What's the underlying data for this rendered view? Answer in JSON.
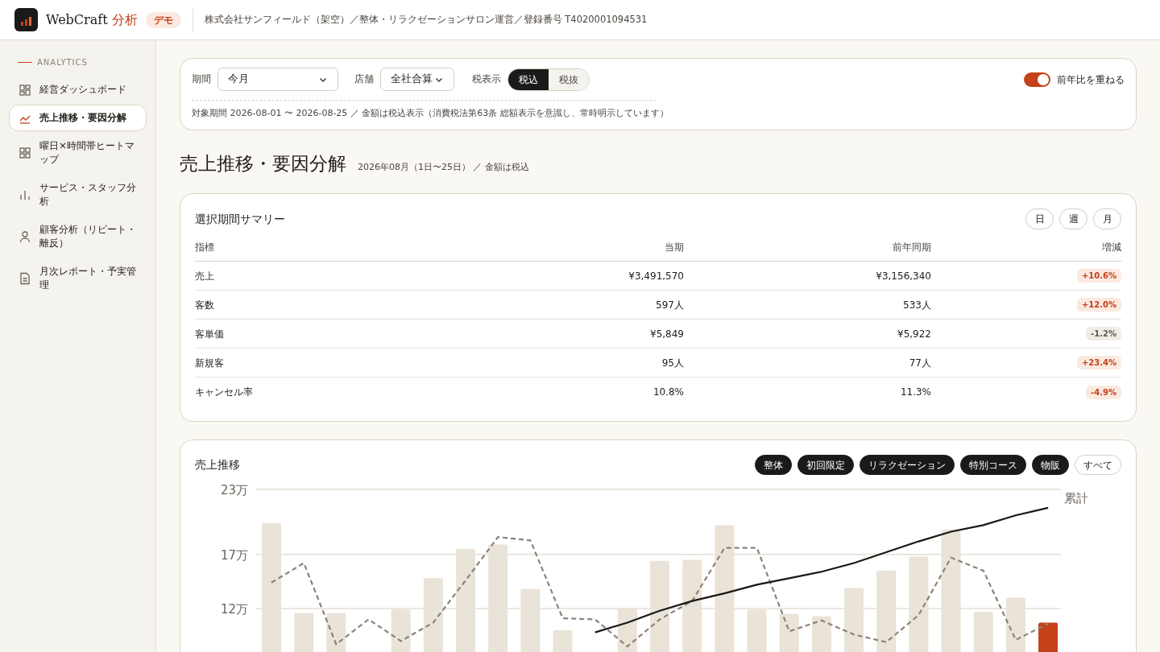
{
  "header": {
    "logo_text": "WebCraft",
    "logo_accent": "分析",
    "badge": "デモ",
    "company": "株式会社サンフィールド（架空）／整体・リラクゼーションサロン運営／登録番号 T4020001094531"
  },
  "sidebar": {
    "section": "ANALYTICS",
    "items": [
      {
        "label": "経営ダッシュボード",
        "selected": false
      },
      {
        "label": "売上推移・要因分解",
        "selected": true
      },
      {
        "label": "曜日×時間帯ヒートマップ",
        "selected": false
      },
      {
        "label": "サービス・スタッフ分析",
        "selected": false
      },
      {
        "label": "顧客分析（リピート・離反）",
        "selected": false
      },
      {
        "label": "月次レポート・予実管理",
        "selected": false
      }
    ]
  },
  "filters": {
    "period_label": "期間",
    "period_value": "今月",
    "store_label": "店舗",
    "store_value": "全社合算",
    "tax_label": "税表示",
    "tax_options": [
      {
        "label": "税込",
        "selected": true
      },
      {
        "label": "税抜",
        "selected": false
      }
    ],
    "overlay": {
      "label": "前年比を重ねる",
      "on": true
    },
    "note": "対象期間 2026-08-01 〜 2026-08-25 ／ 金額は税込表示（消費税法第63条 総額表示を意識し、常時明示しています）"
  },
  "page": {
    "title": "売上推移・要因分解",
    "subtitle": "2026年08月（1日〜25日） ／ 金額は税込"
  },
  "summary": {
    "title": "選択期間サマリー",
    "granularity": [
      {
        "label": "日",
        "selected": false
      },
      {
        "label": "週",
        "selected": false
      },
      {
        "label": "月",
        "selected": false
      }
    ],
    "columns": [
      "指標",
      "当期",
      "前年同期",
      "増減"
    ],
    "rows": [
      {
        "metric": "売上",
        "current": "¥3,491,570",
        "previous": "¥3,156,340",
        "change": "+10.6%",
        "kind": "good"
      },
      {
        "metric": "客数",
        "current": "597人",
        "previous": "533人",
        "change": "+12.0%",
        "kind": "good"
      },
      {
        "metric": "客単価",
        "current": "¥5,849",
        "previous": "¥5,922",
        "change": "-1.2%",
        "kind": "bad"
      },
      {
        "metric": "新規客",
        "current": "95人",
        "previous": "77人",
        "change": "+23.4%",
        "kind": "good"
      },
      {
        "metric": "キャンセル率",
        "current": "10.8%",
        "previous": "11.3%",
        "change": "-4.9%",
        "kind": "good"
      }
    ]
  },
  "trend": {
    "title": "売上推移",
    "chips": [
      {
        "label": "整体",
        "selected": true
      },
      {
        "label": "初回限定",
        "selected": true
      },
      {
        "label": "リラクゼーション",
        "selected": true
      },
      {
        "label": "特別コース",
        "selected": true
      },
      {
        "label": "物販",
        "selected": true
      },
      {
        "label": "すべて",
        "selected": false
      }
    ],
    "chart_data": {
      "type": "bar",
      "ylim": [
        0,
        23
      ],
      "yticks": [
        {
          "value": 12,
          "label": "12万"
        },
        {
          "value": 17,
          "label": "17万"
        },
        {
          "value": 23,
          "label": "23万"
        }
      ],
      "series": [
        {
          "color": "#e9e3d8",
          "values": [
            19.9,
            11.6,
            11.6,
            null,
            11.9,
            14.8,
            17.5,
            17.9,
            13.8,
            10,
            null,
            12,
            16.4,
            16.5,
            19.7,
            11.9,
            11.5,
            11.3,
            13.9,
            15.5,
            16.8,
            19.3,
            11.7,
            13,
            null
          ]
        },
        {
          "color": "#c4411a",
          "values": [
            null,
            null,
            null,
            null,
            null,
            null,
            null,
            null,
            null,
            null,
            null,
            null,
            null,
            null,
            null,
            null,
            null,
            null,
            null,
            null,
            null,
            null,
            null,
            null,
            10.7
          ]
        },
        {
          "type": "line",
          "line_style": "dashed",
          "color": "#8c8279",
          "values": [
            14.4,
            16.2,
            8.7,
            11,
            9,
            10.7,
            14.6,
            18.6,
            18.3,
            11.1,
            11,
            8.5,
            11,
            12.7,
            17.6,
            17.6,
            9.9,
            10.9,
            9.6,
            8.9,
            11.4,
            16.7,
            15.5,
            9.1,
            10.6
          ]
        },
        {
          "type": "line",
          "name": "累計",
          "line_style": "solid",
          "color": "#1a1714",
          "values": [
            null,
            null,
            null,
            null,
            null,
            null,
            null,
            null,
            null,
            null,
            9.8,
            10.7,
            11.8,
            12.7,
            13.4,
            14.2,
            14.8,
            15.4,
            16.2,
            17.2,
            18.2,
            19.1,
            19.7,
            20.6,
            21.3
          ]
        }
      ]
    }
  }
}
